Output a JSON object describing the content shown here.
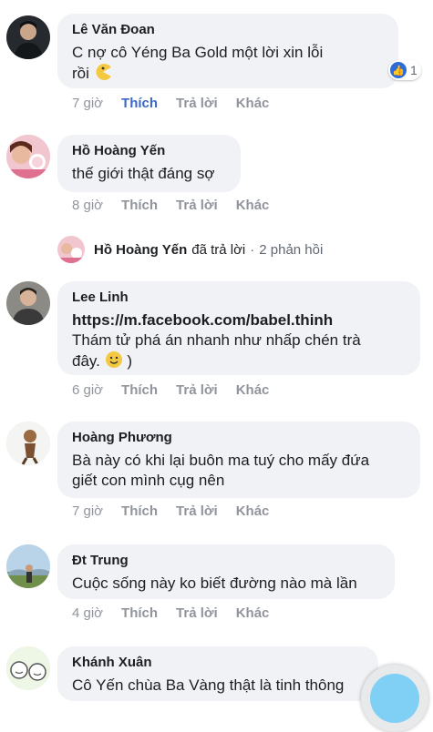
{
  "comments": [
    {
      "author": "Lê Văn Đoan",
      "text_line1": "C    nợ cô Yéng Ba Gold một lời xin lỗi",
      "text_line2": "rồi",
      "time": "7 giờ",
      "like": "Thích",
      "reply": "Trả lời",
      "more": "Khác",
      "reaction_count": "1",
      "avatar_icon": "person-avatar-icon"
    },
    {
      "author": "Hồ Hoàng Yến",
      "text": "thế giới thật đáng sợ",
      "time": "8 giờ",
      "like": "Thích",
      "reply": "Trả lời",
      "more": "Khác",
      "avatar_icon": "person-avatar-icon"
    },
    {
      "author": "Lee Linh",
      "link": "https://m.facebook.com/babel.thinh",
      "text_line1": "Thám tử phá án nhanh như nhấp chén trà",
      "text_line2": "đây.",
      "text_line2_suffix": ")",
      "time": "6 giờ",
      "like": "Thích",
      "reply": "Trả lời",
      "more": "Khác",
      "avatar_icon": "person-avatar-icon"
    },
    {
      "author": "Hoàng Phương",
      "text_line1": "Bà này có khi lại buôn ma tuý cho mấy đứa",
      "text_line2": "giết con mình cụg nên",
      "time": "7 giờ",
      "like": "Thích",
      "reply": "Trả lời",
      "more": "Khác",
      "avatar_icon": "person-avatar-icon"
    },
    {
      "author": "Đt Trung",
      "text": "Cuộc sống này ko biết đường nào mà lần",
      "time": "4 giờ",
      "like": "Thích",
      "reply": "Trả lời",
      "more": "Khác",
      "avatar_icon": "person-avatar-icon"
    },
    {
      "author": "Khánh Xuân",
      "text": "Cô Yến chùa Ba Vàng thật là tinh thông",
      "avatar_icon": "person-avatar-icon"
    }
  ],
  "reply_summary": {
    "name": "Hồ Hoàng Yến",
    "action": "đã trả lời",
    "separator": "·",
    "count_text": "2 phản hồi"
  },
  "colors": {
    "bubble": "#f0f2f5",
    "liked": "#3b68c7",
    "muted": "#90949c",
    "like_badge": "#2d6cd6"
  }
}
